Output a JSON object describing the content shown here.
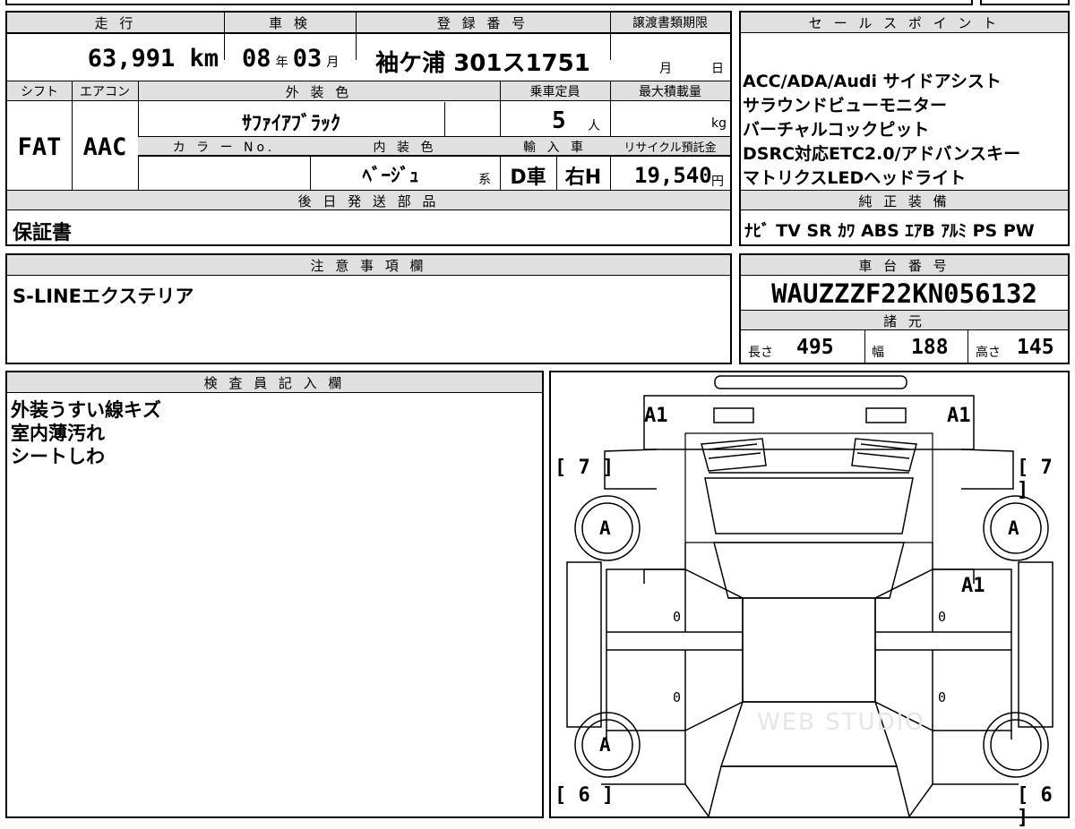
{
  "top_table": {
    "headers": {
      "mileage": "走 行",
      "inspection": "車 検",
      "registration": "登 録 番 号",
      "transfer_deadline": "譲渡書類期限",
      "shift": "シフト",
      "aircon": "エアコン",
      "exterior_color": "外 装 色",
      "capacity": "乗車定員",
      "max_load": "最大積載量",
      "color_no": "カ ラ ー No.",
      "interior_color": "内 装 色",
      "import": "輸 入 車",
      "recycle": "リサイクル預託金"
    },
    "mileage_value": "63,991 km",
    "inspection_year": "08",
    "inspection_year_unit": "年",
    "inspection_month": "03",
    "inspection_month_unit": "月",
    "registration_value": "袖ケ浦 301ス1751",
    "deadline_month": "月",
    "deadline_day": "日",
    "shift_value": "FAT",
    "aircon_value": "AAC",
    "exterior_color_value": "ｻﾌｧｲｱﾌﾞﾗｯｸ",
    "capacity_value": "5",
    "capacity_unit": "人",
    "max_load_unit": "kg",
    "interior_color_value": "ﾍﾞｰｼﾞｭ",
    "interior_suffix": "系",
    "import_type": "D車",
    "handle": "右H",
    "recycle_value": "19,540",
    "recycle_unit": "円",
    "later_parts_header": "後 日 発 送 部 品",
    "later_parts_value": "保証書"
  },
  "sales_points": {
    "header": "セ ー ル ス ポ イ ン ト",
    "lines": [
      "ACC/ADA/Audi サイドアシスト",
      "サラウンドビューモニター",
      "バーチャルコックピット",
      "DSRC対応ETC2.0/アドバンスキー",
      "マトリクスLEDヘッドライト"
    ]
  },
  "equipment": {
    "header": "純 正 装 備",
    "value": "ﾅﾋﾞ TV SR ｶﾜ ABS ｴｱB ｱﾙﾐ PS PW"
  },
  "notes": {
    "header": "注 意 事 項 欄",
    "value": "S-LINEエクステリア"
  },
  "chassis": {
    "header": "車 台 番 号",
    "value": "WAUZZZF22KN056132",
    "spec_header": "諸 元",
    "length_label": "長さ",
    "length_value": "495",
    "width_label": "幅",
    "width_value": "188",
    "height_label": "高さ",
    "height_value": "145"
  },
  "inspector": {
    "header": "検 査 員 記 入 欄",
    "lines": [
      "外装うすい線キズ",
      "室内薄汚れ",
      "シートしわ"
    ]
  },
  "diagram": {
    "marks": {
      "front_left_a1": "A1",
      "front_right_a1": "A1",
      "right_door_a1": "A1",
      "wheel_fl": "A",
      "wheel_fr": "A",
      "wheel_rl": "A",
      "tire_front_left": "[ 7 ]",
      "tire_front_right": "[ 7 ]",
      "tire_rear_left": "[ 6 ]",
      "tire_rear_right": "[ 6 ]",
      "door_fl": "0",
      "door_fr": "0",
      "door_rl": "0",
      "door_rr": "0"
    },
    "watermark": "WEB STUDIO"
  }
}
